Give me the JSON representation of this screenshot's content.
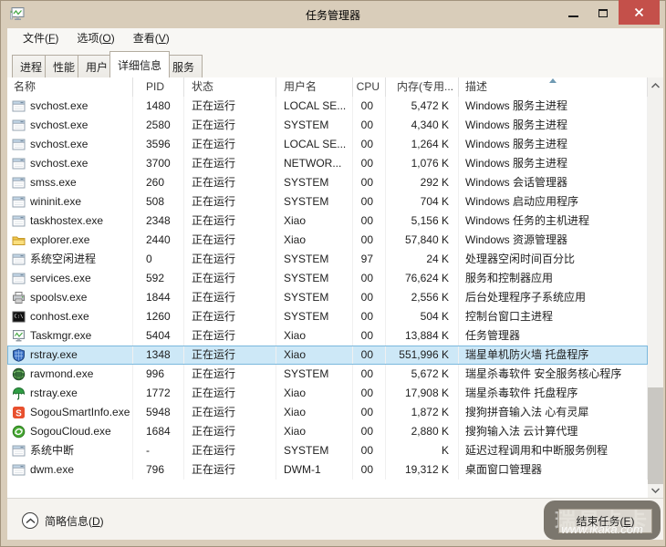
{
  "window": {
    "title": "任务管理器",
    "controls": {
      "minimize": "–",
      "maximize": "□",
      "close": "✕"
    },
    "app_icon": "taskmgr-icon"
  },
  "menu": {
    "items": [
      {
        "pre": "文件(",
        "key": "F",
        "post": ")"
      },
      {
        "pre": "选项(",
        "key": "O",
        "post": ")"
      },
      {
        "pre": "查看(",
        "key": "V",
        "post": ")"
      }
    ]
  },
  "tabs": [
    {
      "label": "进程",
      "active": false
    },
    {
      "label": "性能",
      "active": false
    },
    {
      "label": "用户",
      "active": false
    },
    {
      "label": "详细信息",
      "active": true
    },
    {
      "label": "服务",
      "active": false
    }
  ],
  "table": {
    "columns": [
      {
        "key": "name",
        "label": "名称"
      },
      {
        "key": "pid",
        "label": "PID"
      },
      {
        "key": "status",
        "label": "状态"
      },
      {
        "key": "user",
        "label": "用户名"
      },
      {
        "key": "cpu",
        "label": "CPU"
      },
      {
        "key": "mem",
        "label": "内存(专用..."
      },
      {
        "key": "desc",
        "label": "描述",
        "sort": "asc"
      }
    ],
    "rows": [
      {
        "icon": "window-icon",
        "name": "svchost.exe",
        "pid": "1480",
        "status": "正在运行",
        "user": "LOCAL SE...",
        "cpu": "00",
        "mem": "5,472 K",
        "desc": "Windows 服务主进程",
        "selected": false
      },
      {
        "icon": "window-icon",
        "name": "svchost.exe",
        "pid": "2580",
        "status": "正在运行",
        "user": "SYSTEM",
        "cpu": "00",
        "mem": "4,340 K",
        "desc": "Windows 服务主进程",
        "selected": false
      },
      {
        "icon": "window-icon",
        "name": "svchost.exe",
        "pid": "3596",
        "status": "正在运行",
        "user": "LOCAL SE...",
        "cpu": "00",
        "mem": "1,264 K",
        "desc": "Windows 服务主进程",
        "selected": false
      },
      {
        "icon": "window-icon",
        "name": "svchost.exe",
        "pid": "3700",
        "status": "正在运行",
        "user": "NETWOR...",
        "cpu": "00",
        "mem": "1,076 K",
        "desc": "Windows 服务主进程",
        "selected": false
      },
      {
        "icon": "window-icon",
        "name": "smss.exe",
        "pid": "260",
        "status": "正在运行",
        "user": "SYSTEM",
        "cpu": "00",
        "mem": "292 K",
        "desc": "Windows 会话管理器",
        "selected": false
      },
      {
        "icon": "window-icon",
        "name": "wininit.exe",
        "pid": "508",
        "status": "正在运行",
        "user": "SYSTEM",
        "cpu": "00",
        "mem": "704 K",
        "desc": "Windows 启动应用程序",
        "selected": false
      },
      {
        "icon": "window-icon",
        "name": "taskhostex.exe",
        "pid": "2348",
        "status": "正在运行",
        "user": "Xiao",
        "cpu": "00",
        "mem": "5,156 K",
        "desc": "Windows 任务的主机进程",
        "selected": false
      },
      {
        "icon": "folder-icon",
        "name": "explorer.exe",
        "pid": "2440",
        "status": "正在运行",
        "user": "Xiao",
        "cpu": "00",
        "mem": "57,840 K",
        "desc": "Windows 资源管理器",
        "selected": false
      },
      {
        "icon": "window-icon",
        "name": "系统空闲进程",
        "pid": "0",
        "status": "正在运行",
        "user": "SYSTEM",
        "cpu": "97",
        "mem": "24 K",
        "desc": "处理器空闲时间百分比",
        "selected": false
      },
      {
        "icon": "window-icon",
        "name": "services.exe",
        "pid": "592",
        "status": "正在运行",
        "user": "SYSTEM",
        "cpu": "00",
        "mem": "76,624 K",
        "desc": "服务和控制器应用",
        "selected": false
      },
      {
        "icon": "printer-icon",
        "name": "spoolsv.exe",
        "pid": "1844",
        "status": "正在运行",
        "user": "SYSTEM",
        "cpu": "00",
        "mem": "2,556 K",
        "desc": "后台处理程序子系统应用",
        "selected": false
      },
      {
        "icon": "console-icon",
        "name": "conhost.exe",
        "pid": "1260",
        "status": "正在运行",
        "user": "SYSTEM",
        "cpu": "00",
        "mem": "504 K",
        "desc": "控制台窗口主进程",
        "selected": false
      },
      {
        "icon": "taskmgr-icon",
        "name": "Taskmgr.exe",
        "pid": "5404",
        "status": "正在运行",
        "user": "Xiao",
        "cpu": "00",
        "mem": "13,884 K",
        "desc": "任务管理器",
        "selected": false
      },
      {
        "icon": "shield-icon",
        "name": "rstray.exe",
        "pid": "1348",
        "status": "正在运行",
        "user": "Xiao",
        "cpu": "00",
        "mem": "551,996 K",
        "desc": "瑞星单机防火墙 托盘程序",
        "selected": true
      },
      {
        "icon": "globe-icon",
        "name": "ravmond.exe",
        "pid": "996",
        "status": "正在运行",
        "user": "SYSTEM",
        "cpu": "00",
        "mem": "5,672 K",
        "desc": "瑞星杀毒软件 安全服务核心程序",
        "selected": false
      },
      {
        "icon": "umbrella-icon",
        "name": "rstray.exe",
        "pid": "1772",
        "status": "正在运行",
        "user": "Xiao",
        "cpu": "00",
        "mem": "17,908 K",
        "desc": "瑞星杀毒软件 托盘程序",
        "selected": false
      },
      {
        "icon": "sogou-s-icon",
        "name": "SogouSmartInfo.exe",
        "pid": "5948",
        "status": "正在运行",
        "user": "Xiao",
        "cpu": "00",
        "mem": "1,872 K",
        "desc": "搜狗拼音输入法 心有灵犀",
        "selected": false
      },
      {
        "icon": "sogou-cloud-icon",
        "name": "SogouCloud.exe",
        "pid": "1684",
        "status": "正在运行",
        "user": "Xiao",
        "cpu": "00",
        "mem": "2,880 K",
        "desc": "搜狗输入法 云计算代理",
        "selected": false
      },
      {
        "icon": "window-icon",
        "name": "系统中断",
        "pid": "-",
        "status": "正在运行",
        "user": "SYSTEM",
        "cpu": "00",
        "mem": "K",
        "desc": "延迟过程调用和中断服务例程",
        "selected": false
      },
      {
        "icon": "window-icon",
        "name": "dwm.exe",
        "pid": "796",
        "status": "正在运行",
        "user": "DWM-1",
        "cpu": "00",
        "mem": "19,312 K",
        "desc": "桌面窗口管理器",
        "selected": false
      }
    ]
  },
  "footer": {
    "toggle": {
      "pre": "简略信息(",
      "key": "D",
      "post": ")"
    },
    "end_task": {
      "pre": "结束任务(",
      "key": "E",
      "post": ")"
    }
  },
  "watermark": {
    "title": "瑞星卡卡",
    "url": "www.ikaka.com"
  },
  "colors": {
    "titlebar": "#d9cdba",
    "close_button": "#c4504a",
    "selection_bg": "#cde8f7",
    "selection_border": "#7ab8dd",
    "watermark_bg": "rgba(88,82,72,0.78)"
  }
}
